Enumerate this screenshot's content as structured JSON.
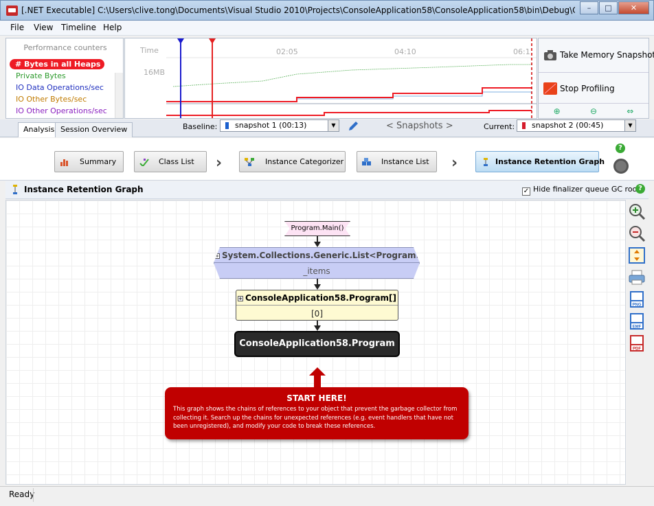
{
  "window": {
    "title": "[.NET Executable] C:\\Users\\clive.tong\\Documents\\Visual Studio 2010\\Projects\\ConsoleApplication58\\ConsoleApplication58\\bin\\Debug\\ConsoleApplica...",
    "controls": [
      "–",
      "□",
      "✕"
    ]
  },
  "menu": [
    "File",
    "View",
    "Timeline",
    "Help"
  ],
  "counters": {
    "title": "Performance counters",
    "items": [
      {
        "label": "# Bytes in all Heaps",
        "color": "#ffffff",
        "selected": true
      },
      {
        "label": "Private Bytes",
        "color": "#2c9a2c"
      },
      {
        "label": "IO Data Operations/sec",
        "color": "#1f2fbf"
      },
      {
        "label": "IO Other Bytes/sec",
        "color": "#c07a00"
      },
      {
        "label": "IO Other Operations/sec",
        "color": "#8a1fbf"
      }
    ]
  },
  "timeline": {
    "time_label": "Time",
    "ticks": [
      "02:05",
      "04:10",
      "06:1"
    ],
    "y_label": "16MB"
  },
  "actions": {
    "take_snapshot": "Take Memory Snapshot",
    "stop_profiling": "Stop Profiling"
  },
  "tabs": [
    "Analysis",
    "Session Overview"
  ],
  "snapshots": {
    "baseline_label": "Baseline:",
    "baseline_value": "snapshot 1 (00:13)",
    "nav": "< Snapshots >",
    "current_label": "Current:",
    "current_value": "snapshot 2 (00:45)"
  },
  "nav_buttons": [
    {
      "label": "Summary"
    },
    {
      "label": "Class List"
    },
    {
      "label": "Instance Categorizer"
    },
    {
      "label": "Instance List"
    },
    {
      "label": "Instance Retention Graph",
      "active": true
    }
  ],
  "section": {
    "title": "Instance Retention Graph",
    "hide_finalizer": "Hide finalizer queue GC roots",
    "hide_finalizer_checked": true
  },
  "graph": {
    "root": "Program.Main()",
    "list_node": {
      "title": "System.Collections.Generic.List<Program>",
      "field": "_items"
    },
    "array_node": {
      "title": "ConsoleApplication58.Program[]",
      "field": "[0]"
    },
    "target_node": "ConsoleApplication58.Program",
    "start_here": {
      "title": "START HERE!",
      "text": "This graph shows the chains of references to your object that prevent the garbage collector from collecting it. Search up the chains for unexpected references (e.g. event handlers that have not been unregistered), and modify your code to break these references."
    }
  },
  "status": "Ready"
}
